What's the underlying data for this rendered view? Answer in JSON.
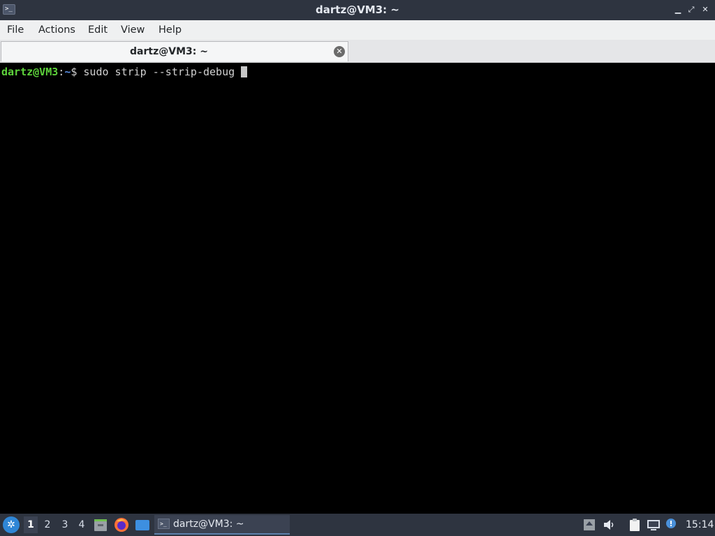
{
  "window": {
    "title": "dartz@VM3: ~",
    "app_icon": "terminal-icon",
    "controls": [
      "minimize-icon",
      "maximize-icon",
      "close-icon"
    ]
  },
  "menubar": {
    "items": [
      {
        "label": "File"
      },
      {
        "label": "Actions"
      },
      {
        "label": "Edit"
      },
      {
        "label": "View"
      },
      {
        "label": "Help"
      }
    ]
  },
  "tabs": [
    {
      "label": "dartz@VM3: ~",
      "active": true,
      "close_icon": "close-circle-icon"
    }
  ],
  "terminal": {
    "prompt_user": "dartz@VM3",
    "prompt_sep": ":",
    "prompt_path": "~",
    "prompt_symbol": "$",
    "command": "sudo strip --strip-debug",
    "colors": {
      "user": "#5dd23b",
      "path": "#5a8ee0",
      "background": "#000000"
    }
  },
  "taskbar": {
    "start_icon": "lxqt-menu-icon",
    "workspaces": [
      "1",
      "2",
      "3",
      "4"
    ],
    "active_workspace": "1",
    "launchers": [
      "file-manager-icon",
      "firefox-icon",
      "show-desktop-icon"
    ],
    "task": {
      "label": "dartz@VM3: ~",
      "icon": "terminal-icon"
    },
    "tray": [
      "update-notifier-icon",
      "volume-icon",
      "clipboard-icon",
      "network-icon",
      "notification-icon"
    ],
    "clock": "15:14"
  }
}
